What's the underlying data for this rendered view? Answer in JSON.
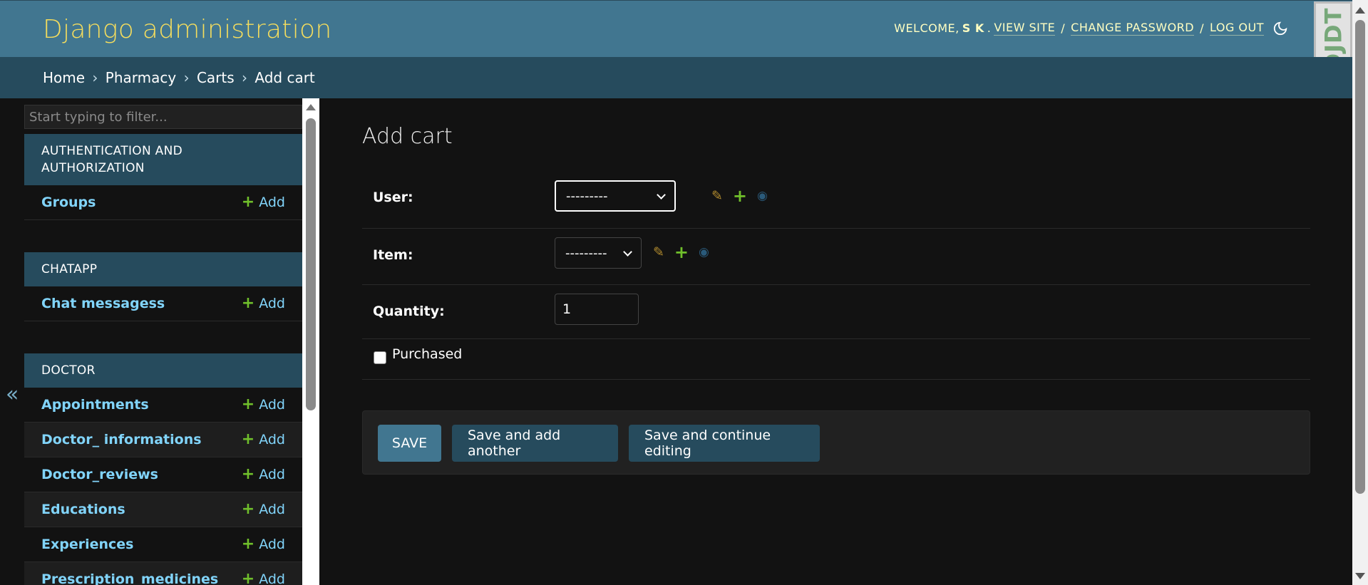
{
  "header": {
    "site_name": "Django administration",
    "welcome": "WELCOME,",
    "username": "S K",
    "view_site": "VIEW SITE",
    "change_password": "CHANGE PASSWORD",
    "log_out": "LOG OUT",
    "theme_icon": "moon-icon",
    "debug_toolbar": "DJDT"
  },
  "breadcrumbs": {
    "home": "Home",
    "app": "Pharmacy",
    "model": "Carts",
    "current": "Add cart",
    "separator": "›"
  },
  "sidebar": {
    "toggle": "«",
    "filter_placeholder": "Start typing to filter...",
    "add_label": "Add",
    "modules": [
      {
        "caption": "AUTHENTICATION AND AUTHORIZATION",
        "models": [
          "Groups"
        ]
      },
      {
        "caption": "CHATAPP",
        "models": [
          "Chat messagess"
        ]
      },
      {
        "caption": "DOCTOR",
        "models": [
          "Appointments",
          "Doctor_ informations",
          "Doctor_reviews",
          "Educations",
          "Experiences",
          "Prescription_medicines"
        ]
      }
    ]
  },
  "main": {
    "title": "Add cart",
    "fields": {
      "user": {
        "label": "User:",
        "value": "---------"
      },
      "item": {
        "label": "Item:",
        "value": "---------"
      },
      "quantity": {
        "label": "Quantity:",
        "value": "1"
      },
      "purchased": {
        "label": "Purchased",
        "checked": false
      }
    },
    "buttons": {
      "save": "SAVE",
      "save_add_another": "Save and add another",
      "save_continue": "Save and continue editing"
    }
  },
  "colors": {
    "header_bg": "#417690",
    "breadcrumb_bg": "#264b5d",
    "brand_text": "#f5dd5d",
    "link": "#81d4fa",
    "add_plus": "#70bf2b",
    "body_bg": "#121212"
  }
}
